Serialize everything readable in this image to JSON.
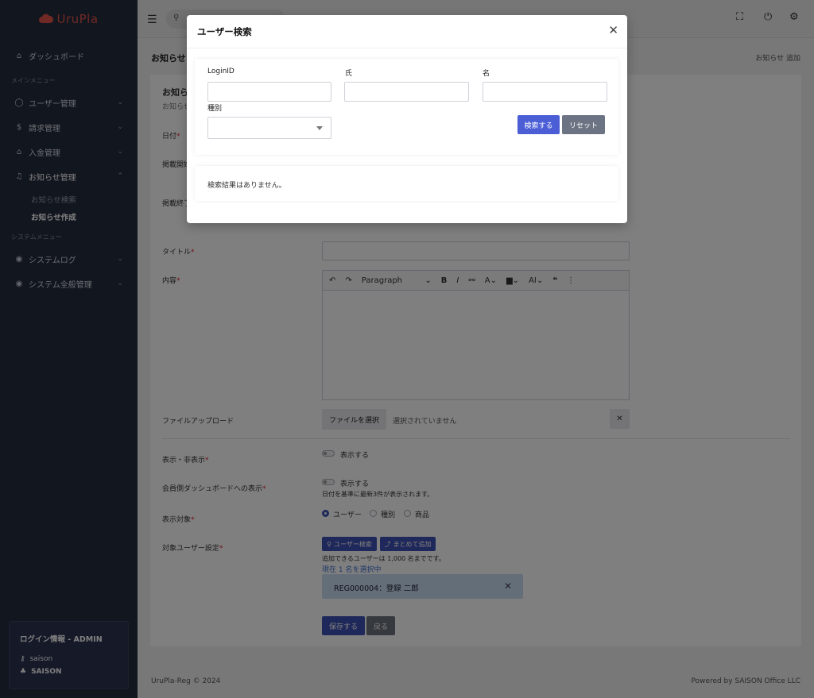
{
  "app": {
    "logo_text": "UruPla",
    "brand_color": "#e0524a"
  },
  "sidebar": {
    "dashboard": "ダッシュボード",
    "section_main": "メインメニュー",
    "items": [
      {
        "label": "ユーザー管理",
        "icon": "user-icon"
      },
      {
        "label": "請求管理",
        "icon": "dollar-icon"
      },
      {
        "label": "入金管理",
        "icon": "bank-icon"
      },
      {
        "label": "お知らせ管理",
        "icon": "bell-icon"
      }
    ],
    "sub_items": [
      {
        "label": "お知らせ検索",
        "active": false
      },
      {
        "label": "お知らせ作成",
        "active": true
      }
    ],
    "section_system": "システムメニュー",
    "system_items": [
      {
        "label": "システムログ",
        "icon": "globe-icon"
      },
      {
        "label": "システム全般管理",
        "icon": "globe-icon"
      }
    ],
    "login": {
      "title": "ログイン情報 - ADMIN",
      "user": "saison",
      "org": "SAISON"
    }
  },
  "page": {
    "title": "お知らせ",
    "breadcrumb": "お知らせ 追加",
    "card_title": "お知ら",
    "card_subtitle": "お知らせ",
    "labels": {
      "date": "日付",
      "pub_start": "掲載開始",
      "pub_end": "掲載終了",
      "title": "タイトル",
      "content": "内容",
      "file_upload": "ファイルアップロード",
      "visibility": "表示・非表示",
      "member_dash": "会員側ダッシュボードへの表示",
      "target": "表示対象",
      "target_user": "対象ユーザー設定"
    },
    "editor_paragraph": "Paragraph",
    "file_button": "ファイルを選択",
    "file_none": "選択されていません",
    "show_label": "表示する",
    "show_label2": "表示する",
    "dash_note": "日付を基準に最新3件が表示されます。",
    "target_options": [
      "ユーザー",
      "種別",
      "商品"
    ],
    "user_search_btn": "ユーザー検索",
    "bulk_add_btn": "まとめて追加",
    "limit_note": "追加できるユーザーは 1,000 名までです。",
    "selected_note": "現在 1 名を選択中",
    "selected_user": "REG000004：登録 二郎",
    "save": "保存する",
    "back": "戻る"
  },
  "footer": {
    "left": "UruPla-Reg © 2024",
    "right": "Powered by SAISON Office LLC"
  },
  "modal": {
    "title": "ユーザー検索",
    "fields": {
      "login_id": "LoginID",
      "last_name": "氏",
      "first_name": "名",
      "type": "種別"
    },
    "search_button": "検索する",
    "reset_button": "リセット",
    "no_results": "検索結果はありません。"
  }
}
